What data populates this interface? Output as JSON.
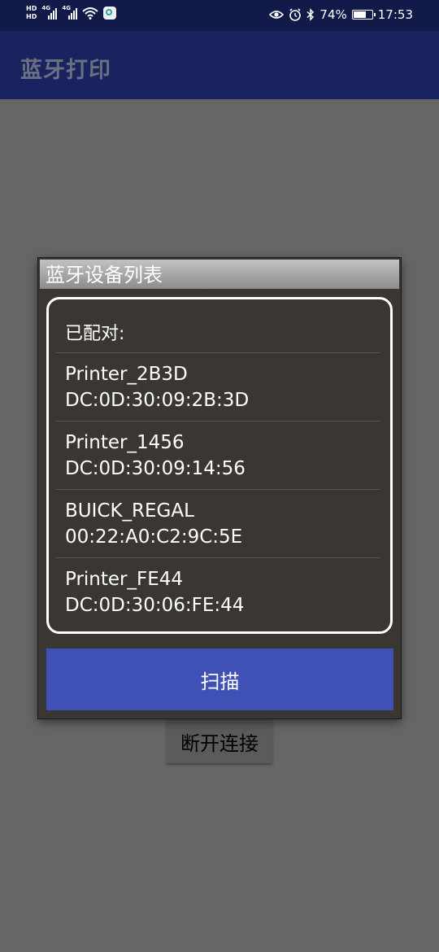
{
  "status_bar": {
    "left_labels": [
      "HD",
      "HD"
    ],
    "network_1": "4G",
    "network_2": "4G",
    "battery_percent": "74%",
    "battery_level": 0.74,
    "time": "17:53",
    "icons": [
      "eye-icon",
      "alarm-icon",
      "bluetooth-icon",
      "battery-icon",
      "wifi-icon",
      "signal-icon",
      "app-notification-icon"
    ]
  },
  "app_bar": {
    "title": "蓝牙打印"
  },
  "background": {
    "disconnect_label": "断开连接"
  },
  "dialog": {
    "title": "蓝牙设备列表",
    "paired_header": "已配对:",
    "devices": [
      {
        "name": "Printer_2B3D",
        "address": "DC:0D:30:09:2B:3D"
      },
      {
        "name": "Printer_1456",
        "address": "DC:0D:30:09:14:56"
      },
      {
        "name": "BUICK_REGAL",
        "address": "00:22:A0:C2:9C:5E"
      },
      {
        "name": "Printer_FE44",
        "address": "DC:0D:30:06:FE:44"
      }
    ],
    "scan_label": "扫描"
  },
  "colors": {
    "status_bar_bg": "#121a4a",
    "app_bar_bg": "#1a2260",
    "scrim": "#666666",
    "dialog_bg": "#3a3733",
    "scan_button_bg": "#3f51b5"
  }
}
